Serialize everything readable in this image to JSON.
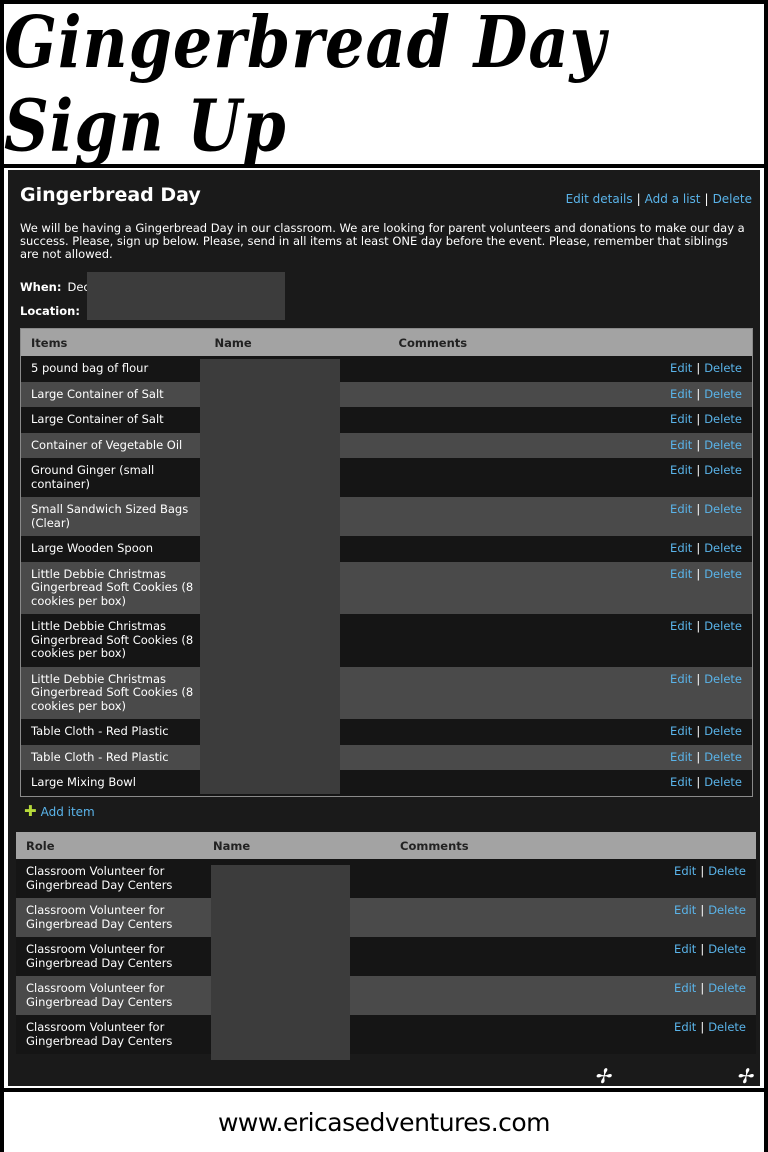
{
  "banner": {
    "title": "Gingerbread Day Sign Up"
  },
  "event": {
    "title": "Gingerbread Day",
    "actions": {
      "edit_details": "Edit details",
      "add_list": "Add a list",
      "delete": "Delete"
    },
    "description": "We will be having a Gingerbread Day in our classroom. We are looking for parent volunteers and donations to make our day a success. Please, sign up below. Please, send in all items at least ONE day before the event. Please, remember that siblings are not allowed.",
    "when_label": "When:",
    "when_value": "Dec",
    "location_label": "Location:"
  },
  "items_table": {
    "headers": {
      "col1": "Items",
      "col2": "Name",
      "col3": "Comments"
    },
    "rows": [
      {
        "item": "5 pound bag of flour"
      },
      {
        "item": "Large Container of Salt"
      },
      {
        "item": "Large Container of Salt"
      },
      {
        "item": "Container of Vegetable Oil"
      },
      {
        "item": "Ground Ginger (small container)"
      },
      {
        "item": "Small Sandwich Sized Bags (Clear)"
      },
      {
        "item": "Large Wooden Spoon"
      },
      {
        "item": "Little Debbie Christmas Gingerbread Soft Cookies (8 cookies per box)"
      },
      {
        "item": "Little Debbie Christmas Gingerbread Soft Cookies (8 cookies per box)"
      },
      {
        "item": "Little Debbie Christmas Gingerbread Soft Cookies (8 cookies per box)"
      },
      {
        "item": "Table Cloth - Red Plastic"
      },
      {
        "item": "Table Cloth - Red Plastic"
      },
      {
        "item": "Large Mixing Bowl"
      }
    ],
    "edit_label": "Edit",
    "delete_label": "Delete",
    "add_item_label": "Add item"
  },
  "roles_table": {
    "headers": {
      "col1": "Role",
      "col2": "Name",
      "col3": "Comments"
    },
    "rows": [
      {
        "role": "Classroom Volunteer for Gingerbread Day Centers"
      },
      {
        "role": "Classroom Volunteer for Gingerbread Day Centers"
      },
      {
        "role": "Classroom Volunteer for Gingerbread Day Centers"
      },
      {
        "role": "Classroom Volunteer for Gingerbread Day Centers"
      },
      {
        "role": "Classroom Volunteer for Gingerbread Day Centers"
      }
    ],
    "edit_label": "Edit",
    "delete_label": "Delete"
  },
  "footer": {
    "url": "www.ericasedventures.com"
  }
}
